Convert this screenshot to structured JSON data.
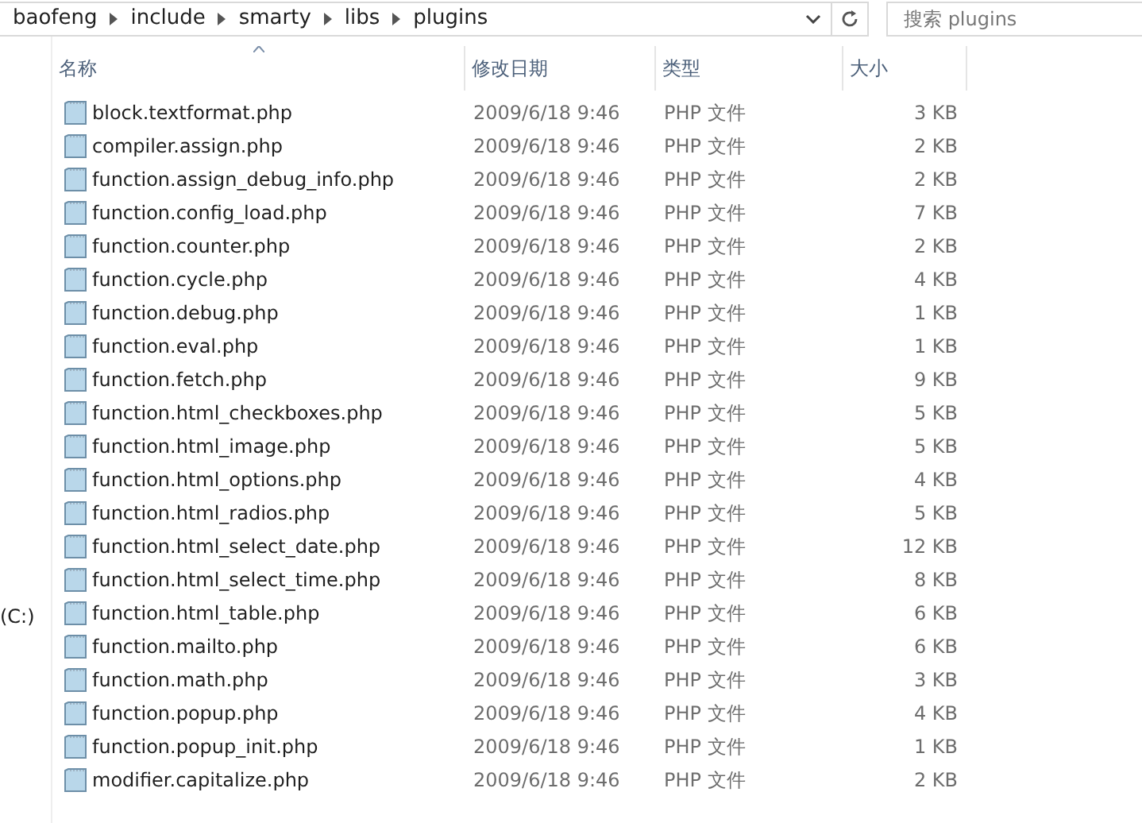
{
  "address_bar": {
    "breadcrumbs": [
      "baofeng",
      "include",
      "smarty",
      "libs",
      "plugins"
    ]
  },
  "search": {
    "placeholder": "搜索 plugins"
  },
  "sidebar": {
    "items": [
      "(C:)"
    ]
  },
  "table": {
    "columns": [
      {
        "label": "名称",
        "sorted": true
      },
      {
        "label": "修改日期",
        "sorted": false
      },
      {
        "label": "类型",
        "sorted": false
      },
      {
        "label": "大小",
        "sorted": false
      }
    ],
    "rows": [
      {
        "name": "block.textformat.php",
        "date": "2009/6/18 9:46",
        "type": "PHP 文件",
        "size": "3 KB"
      },
      {
        "name": "compiler.assign.php",
        "date": "2009/6/18 9:46",
        "type": "PHP 文件",
        "size": "2 KB"
      },
      {
        "name": "function.assign_debug_info.php",
        "date": "2009/6/18 9:46",
        "type": "PHP 文件",
        "size": "2 KB"
      },
      {
        "name": "function.config_load.php",
        "date": "2009/6/18 9:46",
        "type": "PHP 文件",
        "size": "7 KB"
      },
      {
        "name": "function.counter.php",
        "date": "2009/6/18 9:46",
        "type": "PHP 文件",
        "size": "2 KB"
      },
      {
        "name": "function.cycle.php",
        "date": "2009/6/18 9:46",
        "type": "PHP 文件",
        "size": "4 KB"
      },
      {
        "name": "function.debug.php",
        "date": "2009/6/18 9:46",
        "type": "PHP 文件",
        "size": "1 KB"
      },
      {
        "name": "function.eval.php",
        "date": "2009/6/18 9:46",
        "type": "PHP 文件",
        "size": "1 KB"
      },
      {
        "name": "function.fetch.php",
        "date": "2009/6/18 9:46",
        "type": "PHP 文件",
        "size": "9 KB"
      },
      {
        "name": "function.html_checkboxes.php",
        "date": "2009/6/18 9:46",
        "type": "PHP 文件",
        "size": "5 KB"
      },
      {
        "name": "function.html_image.php",
        "date": "2009/6/18 9:46",
        "type": "PHP 文件",
        "size": "5 KB"
      },
      {
        "name": "function.html_options.php",
        "date": "2009/6/18 9:46",
        "type": "PHP 文件",
        "size": "4 KB"
      },
      {
        "name": "function.html_radios.php",
        "date": "2009/6/18 9:46",
        "type": "PHP 文件",
        "size": "5 KB"
      },
      {
        "name": "function.html_select_date.php",
        "date": "2009/6/18 9:46",
        "type": "PHP 文件",
        "size": "12 KB"
      },
      {
        "name": "function.html_select_time.php",
        "date": "2009/6/18 9:46",
        "type": "PHP 文件",
        "size": "8 KB"
      },
      {
        "name": "function.html_table.php",
        "date": "2009/6/18 9:46",
        "type": "PHP 文件",
        "size": "6 KB"
      },
      {
        "name": "function.mailto.php",
        "date": "2009/6/18 9:46",
        "type": "PHP 文件",
        "size": "6 KB"
      },
      {
        "name": "function.math.php",
        "date": "2009/6/18 9:46",
        "type": "PHP 文件",
        "size": "3 KB"
      },
      {
        "name": "function.popup.php",
        "date": "2009/6/18 9:46",
        "type": "PHP 文件",
        "size": "4 KB"
      },
      {
        "name": "function.popup_init.php",
        "date": "2009/6/18 9:46",
        "type": "PHP 文件",
        "size": "1 KB"
      },
      {
        "name": "modifier.capitalize.php",
        "date": "2009/6/18 9:46",
        "type": "PHP 文件",
        "size": "2 KB"
      }
    ]
  }
}
